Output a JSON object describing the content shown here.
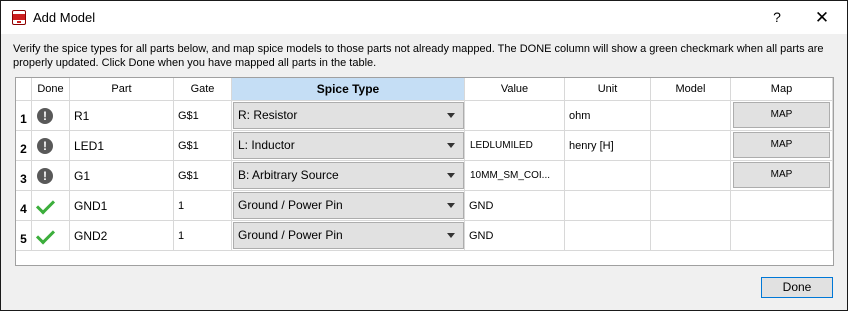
{
  "window": {
    "title": "Add Model",
    "help_glyph": "?",
    "close_glyph": "✕"
  },
  "instructions": "Verify the spice types for all parts below, and map spice models to those parts not already mapped.  The DONE column will show a green checkmark when all parts are properly updated.  Click Done when you have mapped all parts in the table.",
  "table": {
    "headers": {
      "done": "Done",
      "part": "Part",
      "gate": "Gate",
      "spice_type": "Spice Type",
      "value": "Value",
      "unit": "Unit",
      "model": "Model",
      "map": "Map"
    },
    "rows": [
      {
        "num": "1",
        "status": "warning",
        "status_glyph": "!",
        "part": "R1",
        "gate": "G$1",
        "spice_type": "R: Resistor",
        "value": "",
        "unit": "ohm",
        "model": "",
        "map_label": "MAP"
      },
      {
        "num": "2",
        "status": "warning",
        "status_glyph": "!",
        "part": "LED1",
        "gate": "G$1",
        "spice_type": "L: Inductor",
        "value": "LEDLUMILED",
        "unit": "henry [H]",
        "model": "",
        "map_label": "MAP"
      },
      {
        "num": "3",
        "status": "warning",
        "status_glyph": "!",
        "part": "G1",
        "gate": "G$1",
        "spice_type": "B: Arbitrary Source",
        "value": "10MM_SM_COI...",
        "unit": "",
        "model": "",
        "map_label": "MAP"
      },
      {
        "num": "4",
        "status": "done",
        "part": "GND1",
        "gate": "1",
        "spice_type": "Ground / Power Pin",
        "value": "GND",
        "unit": "",
        "model": "",
        "map_label": ""
      },
      {
        "num": "5",
        "status": "done",
        "part": "GND2",
        "gate": "1",
        "spice_type": "Ground / Power Pin",
        "value": "GND",
        "unit": "",
        "model": "",
        "map_label": ""
      }
    ]
  },
  "footer": {
    "done_label": "Done"
  },
  "colors": {
    "check": "#3cae3c",
    "warning": "#595959",
    "active_header": "#c5def5",
    "focus_border": "#0078d7"
  }
}
